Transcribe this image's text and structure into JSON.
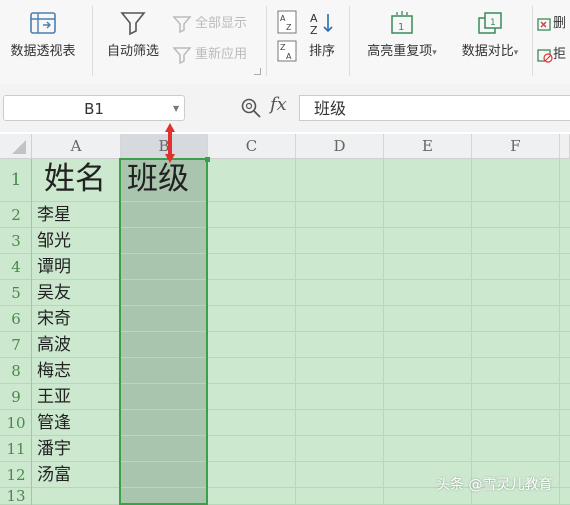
{
  "ribbon": {
    "pivot_table": "数据透视表",
    "auto_filter": "自动筛选",
    "show_all": "全部显示",
    "reapply": "重新应用",
    "sort": "排序",
    "highlight_duplicates": "高亮重复项",
    "data_compare": "数据对比",
    "delete_partial": "删",
    "reject_partial": "拒"
  },
  "formula_bar": {
    "name_box": "B1",
    "fx_label": "fx",
    "formula_value": "班级"
  },
  "columns": [
    "A",
    "B",
    "C",
    "D",
    "E",
    "F"
  ],
  "rows": [
    "1",
    "2",
    "3",
    "4",
    "5",
    "6",
    "7",
    "8",
    "9",
    "10",
    "11",
    "12",
    "13"
  ],
  "cells": {
    "A1": "姓名",
    "B1": "班级",
    "A2": "李星",
    "A3": "邹光",
    "A4": "谭明",
    "A5": "吴友",
    "A6": "宋奇",
    "A7": "高波",
    "A8": "梅志",
    "A9": "王亚",
    "A10": "管逢",
    "A11": "潘宇",
    "A12": "汤富"
  },
  "watermark": "头条 @雪灵儿教育",
  "colors": {
    "selection": "#3aa04a",
    "grid_bg": "#cce8cf",
    "arrow": "#e03030"
  }
}
